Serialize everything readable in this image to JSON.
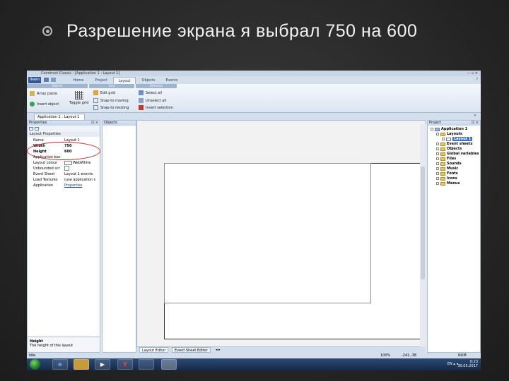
{
  "slide": {
    "title": "Разрешение экрана я выбрал 750 на 600"
  },
  "window": {
    "title": "Construct Classic - [Application 1 : Layout 1]",
    "controls": "— ▫ ✕"
  },
  "ribbon": {
    "file_label": "Файл",
    "tabs": [
      "Home",
      "Project",
      "Layout",
      "Objects",
      "Events"
    ],
    "active_tab": "Layout",
    "help": "?",
    "groups": [
      "Objects",
      "Grid",
      "Selection"
    ],
    "items": {
      "array_paste": "Array paste",
      "insert_object": "Insert object",
      "toggle_grid": "Toggle grid",
      "edit_grid": "Edit grid",
      "snap_moving": "Snap-to moving",
      "snap_resizing": "Snap-to resizing",
      "select_all": "Select all",
      "unselect_all": "Unselect all",
      "invert_selection": "Invert selection"
    }
  },
  "doc_tab": {
    "label": "Application 1 : Layout 1",
    "close": "✕"
  },
  "properties": {
    "title": "Properties",
    "section": "Layout Properties",
    "rows": [
      {
        "key": "Name",
        "value": "Layout 1"
      },
      {
        "key": "Width",
        "value": "750",
        "bold": true
      },
      {
        "key": "Height",
        "value": "600",
        "bold": true
      },
      {
        "key": "Application bac",
        "value": ""
      },
      {
        "key": "Layout colour",
        "value": "WebWhite"
      },
      {
        "key": "Unbounded scr",
        "value": ""
      },
      {
        "key": "Event Sheet",
        "value": "Layout 1 events"
      },
      {
        "key": "Load Textures",
        "value": "(use application s"
      },
      {
        "key": "Application",
        "value": "Properties"
      }
    ],
    "desc_title": "Height",
    "desc_text": "The height of this layout"
  },
  "objects_panel": {
    "title": "Objects"
  },
  "editor_tabs": [
    "Layout Editor",
    "Event Sheet Editor"
  ],
  "editor_arrows": "◂ ▸",
  "project": {
    "title": "Project",
    "root": "Application 1",
    "layouts": "Layouts",
    "selected_layout": "Layout 1",
    "items": [
      "Event sheets",
      "Objects",
      "Global variables",
      "Files",
      "Sounds",
      "Music",
      "Fonts",
      "Icons",
      "Menus"
    ]
  },
  "status": {
    "state": "Idle",
    "zoom": "100%",
    "coords": "-241,-38",
    "num": "NUM"
  },
  "taskbar": {
    "time": "0:23",
    "date": "30.05.2017",
    "tray": "EN ▴ ◂"
  }
}
